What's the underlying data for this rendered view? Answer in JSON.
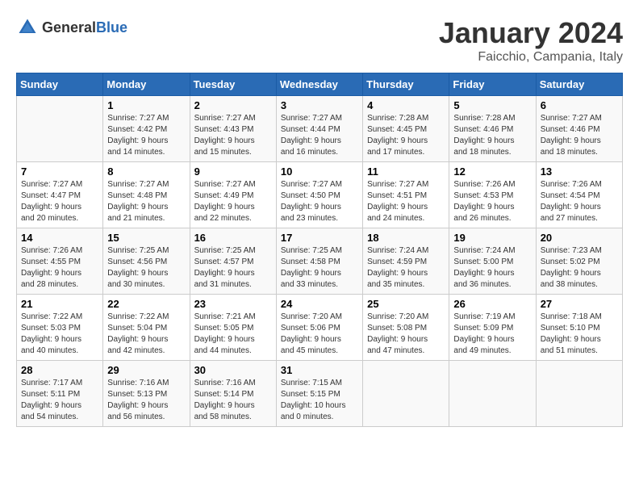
{
  "logo": {
    "general": "General",
    "blue": "Blue"
  },
  "header": {
    "title": "January 2024",
    "subtitle": "Faicchio, Campania, Italy"
  },
  "days_of_week": [
    "Sunday",
    "Monday",
    "Tuesday",
    "Wednesday",
    "Thursday",
    "Friday",
    "Saturday"
  ],
  "weeks": [
    [
      {
        "day": "",
        "info": ""
      },
      {
        "day": "1",
        "info": "Sunrise: 7:27 AM\nSunset: 4:42 PM\nDaylight: 9 hours\nand 14 minutes."
      },
      {
        "day": "2",
        "info": "Sunrise: 7:27 AM\nSunset: 4:43 PM\nDaylight: 9 hours\nand 15 minutes."
      },
      {
        "day": "3",
        "info": "Sunrise: 7:27 AM\nSunset: 4:44 PM\nDaylight: 9 hours\nand 16 minutes."
      },
      {
        "day": "4",
        "info": "Sunrise: 7:28 AM\nSunset: 4:45 PM\nDaylight: 9 hours\nand 17 minutes."
      },
      {
        "day": "5",
        "info": "Sunrise: 7:28 AM\nSunset: 4:46 PM\nDaylight: 9 hours\nand 18 minutes."
      },
      {
        "day": "6",
        "info": "Sunrise: 7:27 AM\nSunset: 4:46 PM\nDaylight: 9 hours\nand 18 minutes."
      }
    ],
    [
      {
        "day": "7",
        "info": "Sunrise: 7:27 AM\nSunset: 4:47 PM\nDaylight: 9 hours\nand 20 minutes."
      },
      {
        "day": "8",
        "info": "Sunrise: 7:27 AM\nSunset: 4:48 PM\nDaylight: 9 hours\nand 21 minutes."
      },
      {
        "day": "9",
        "info": "Sunrise: 7:27 AM\nSunset: 4:49 PM\nDaylight: 9 hours\nand 22 minutes."
      },
      {
        "day": "10",
        "info": "Sunrise: 7:27 AM\nSunset: 4:50 PM\nDaylight: 9 hours\nand 23 minutes."
      },
      {
        "day": "11",
        "info": "Sunrise: 7:27 AM\nSunset: 4:51 PM\nDaylight: 9 hours\nand 24 minutes."
      },
      {
        "day": "12",
        "info": "Sunrise: 7:26 AM\nSunset: 4:53 PM\nDaylight: 9 hours\nand 26 minutes."
      },
      {
        "day": "13",
        "info": "Sunrise: 7:26 AM\nSunset: 4:54 PM\nDaylight: 9 hours\nand 27 minutes."
      }
    ],
    [
      {
        "day": "14",
        "info": "Sunrise: 7:26 AM\nSunset: 4:55 PM\nDaylight: 9 hours\nand 28 minutes."
      },
      {
        "day": "15",
        "info": "Sunrise: 7:25 AM\nSunset: 4:56 PM\nDaylight: 9 hours\nand 30 minutes."
      },
      {
        "day": "16",
        "info": "Sunrise: 7:25 AM\nSunset: 4:57 PM\nDaylight: 9 hours\nand 31 minutes."
      },
      {
        "day": "17",
        "info": "Sunrise: 7:25 AM\nSunset: 4:58 PM\nDaylight: 9 hours\nand 33 minutes."
      },
      {
        "day": "18",
        "info": "Sunrise: 7:24 AM\nSunset: 4:59 PM\nDaylight: 9 hours\nand 35 minutes."
      },
      {
        "day": "19",
        "info": "Sunrise: 7:24 AM\nSunset: 5:00 PM\nDaylight: 9 hours\nand 36 minutes."
      },
      {
        "day": "20",
        "info": "Sunrise: 7:23 AM\nSunset: 5:02 PM\nDaylight: 9 hours\nand 38 minutes."
      }
    ],
    [
      {
        "day": "21",
        "info": "Sunrise: 7:22 AM\nSunset: 5:03 PM\nDaylight: 9 hours\nand 40 minutes."
      },
      {
        "day": "22",
        "info": "Sunrise: 7:22 AM\nSunset: 5:04 PM\nDaylight: 9 hours\nand 42 minutes."
      },
      {
        "day": "23",
        "info": "Sunrise: 7:21 AM\nSunset: 5:05 PM\nDaylight: 9 hours\nand 44 minutes."
      },
      {
        "day": "24",
        "info": "Sunrise: 7:20 AM\nSunset: 5:06 PM\nDaylight: 9 hours\nand 45 minutes."
      },
      {
        "day": "25",
        "info": "Sunrise: 7:20 AM\nSunset: 5:08 PM\nDaylight: 9 hours\nand 47 minutes."
      },
      {
        "day": "26",
        "info": "Sunrise: 7:19 AM\nSunset: 5:09 PM\nDaylight: 9 hours\nand 49 minutes."
      },
      {
        "day": "27",
        "info": "Sunrise: 7:18 AM\nSunset: 5:10 PM\nDaylight: 9 hours\nand 51 minutes."
      }
    ],
    [
      {
        "day": "28",
        "info": "Sunrise: 7:17 AM\nSunset: 5:11 PM\nDaylight: 9 hours\nand 54 minutes."
      },
      {
        "day": "29",
        "info": "Sunrise: 7:16 AM\nSunset: 5:13 PM\nDaylight: 9 hours\nand 56 minutes."
      },
      {
        "day": "30",
        "info": "Sunrise: 7:16 AM\nSunset: 5:14 PM\nDaylight: 9 hours\nand 58 minutes."
      },
      {
        "day": "31",
        "info": "Sunrise: 7:15 AM\nSunset: 5:15 PM\nDaylight: 10 hours\nand 0 minutes."
      },
      {
        "day": "",
        "info": ""
      },
      {
        "day": "",
        "info": ""
      },
      {
        "day": "",
        "info": ""
      }
    ]
  ]
}
